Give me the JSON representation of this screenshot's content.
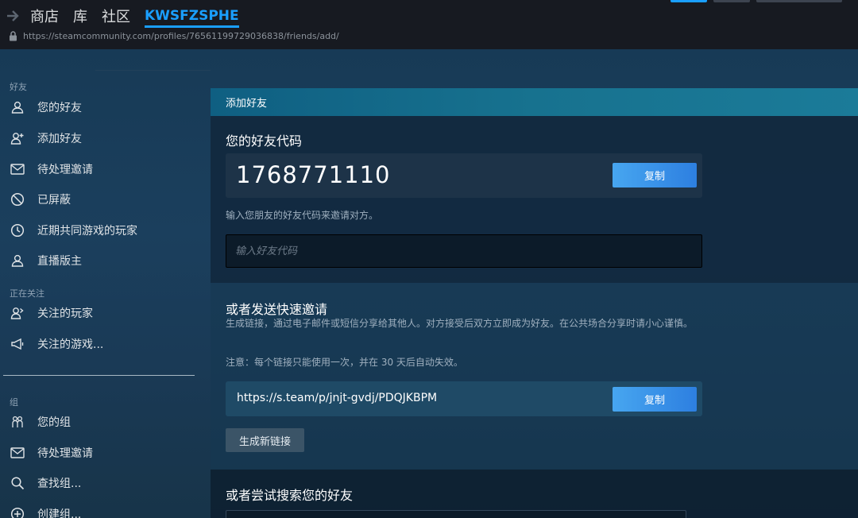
{
  "topnav": {
    "items": [
      "商店",
      "库",
      "社区"
    ],
    "username": "KWSFZSPHE",
    "url": "https://steamcommunity.com/profiles/76561199729036838/friends/add/"
  },
  "sidebar": {
    "friends_header": "好友",
    "friends_items": [
      {
        "label": "您的好友",
        "icon": "person-icon"
      },
      {
        "label": "添加好友",
        "icon": "person-add-icon"
      },
      {
        "label": "待处理邀请",
        "icon": "envelope-icon"
      },
      {
        "label": "已屏蔽",
        "icon": "block-icon"
      },
      {
        "label": "近期共同游戏的玩家",
        "icon": "clock-icon"
      },
      {
        "label": "直播版主",
        "icon": "person-icon"
      }
    ],
    "following_header": "正在关注",
    "following_items": [
      {
        "label": "关注的玩家",
        "icon": "person-follow-icon"
      },
      {
        "label": "关注的游戏...",
        "icon": "megaphone-icon"
      }
    ],
    "groups_header": "组",
    "groups_items": [
      {
        "label": "您的组",
        "icon": "group-icon"
      },
      {
        "label": "待处理邀请",
        "icon": "envelope-icon"
      },
      {
        "label": "查找组...",
        "icon": "search-icon"
      },
      {
        "label": "创建组...",
        "icon": "plus-circle-icon"
      }
    ]
  },
  "panel": {
    "header": "添加好友",
    "friend_code_title": "您的好友代码",
    "friend_code": "1768771110",
    "copy_label": "复制",
    "enter_hint": "输入您朋友的好友代码来邀请对方。",
    "input_placeholder": "输入好友代码",
    "quick_invite_title": "或者发送快速邀请",
    "quick_invite_desc": "生成链接，通过电子邮件或短信分享给其他人。对方接受后双方立即成为好友。在公共场合分享时请小心谨慎。",
    "quick_invite_note": "注意：每个链接只能使用一次，并在 30 天后自动失效。",
    "invite_link": "https://s.team/p/jnjt-gvdj/PDQJKBPM",
    "generate_label": "生成新链接",
    "search_title": "或者尝试搜索您的好友"
  },
  "colors": {
    "accent": "#1a9fff",
    "button_blue": "#3a8fe8",
    "header_teal": "#17728f"
  }
}
